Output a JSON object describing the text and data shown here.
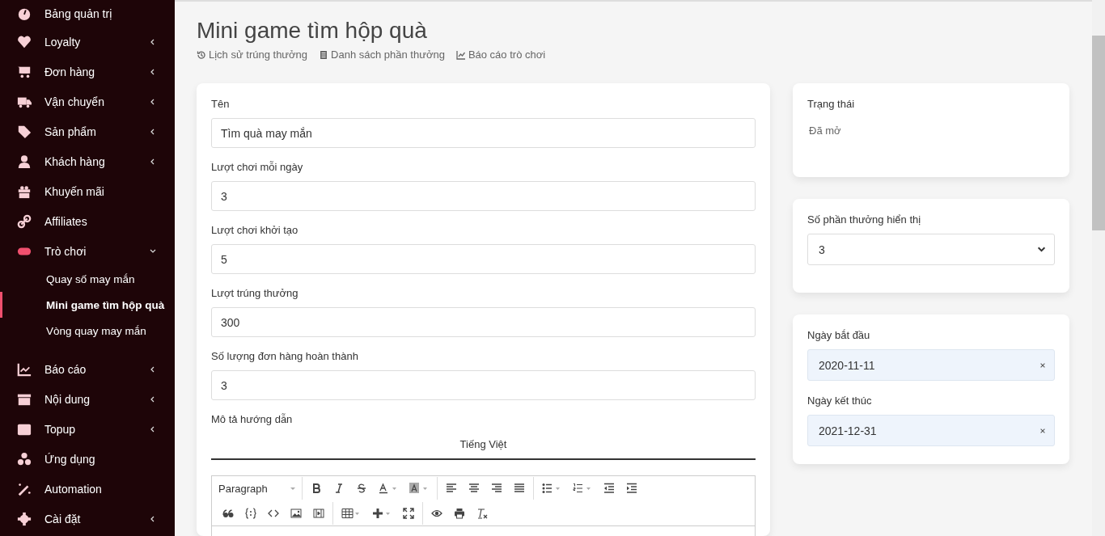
{
  "sidebar": {
    "items": [
      {
        "label": "Bảng quản trị",
        "kind": "link"
      },
      {
        "label": "Loyalty",
        "kind": "group",
        "expanded": false
      },
      {
        "label": "Đơn hàng",
        "kind": "group",
        "expanded": false
      },
      {
        "label": "Vận chuyển",
        "kind": "group",
        "expanded": false
      },
      {
        "label": "Sản phẩm",
        "kind": "group",
        "expanded": false
      },
      {
        "label": "Khách hàng",
        "kind": "group",
        "expanded": false
      },
      {
        "label": "Khuyến mãi",
        "kind": "link"
      },
      {
        "label": "Affiliates",
        "kind": "link"
      },
      {
        "label": "Trò chơi",
        "kind": "group",
        "expanded": true,
        "children": [
          {
            "label": "Quay số may mắn",
            "selected": false
          },
          {
            "label": "Mini game tìm hộp quà",
            "selected": true
          },
          {
            "label": "Vòng quay may mắn",
            "selected": false
          }
        ]
      },
      {
        "label": "Báo cáo",
        "kind": "group",
        "expanded": false
      },
      {
        "label": "Nội dung",
        "kind": "group",
        "expanded": false
      },
      {
        "label": "Topup",
        "kind": "group",
        "expanded": false
      },
      {
        "label": "Ứng dụng",
        "kind": "link"
      },
      {
        "label": "Automation",
        "kind": "link"
      },
      {
        "label": "Cài đặt",
        "kind": "group",
        "expanded": false
      }
    ]
  },
  "page": {
    "title": "Mini game tìm hộp quà",
    "links": [
      "Lịch sử trúng thưởng",
      "Danh sách phần thưởng",
      "Báo cáo trò chơi"
    ]
  },
  "form": {
    "fields": [
      {
        "label": "Tên",
        "value": "Tìm quà may mắn"
      },
      {
        "label": "Lượt chơi mỗi ngày",
        "value": "3"
      },
      {
        "label": "Lượt chơi khởi tạo",
        "value": "5"
      },
      {
        "label": "Lượt trúng thưởng",
        "value": "300"
      },
      {
        "label": "Số lượng đơn hàng hoàn thành",
        "value": "3"
      }
    ],
    "description": {
      "label": "Mô tả hướng dẫn",
      "language_tab": "Tiếng Việt",
      "format": "Paragraph"
    }
  },
  "status": {
    "label": "Trạng thái",
    "value": "Đã mở"
  },
  "display_count": {
    "label": "Số phần thưởng hiển thị",
    "value": "3"
  },
  "dates": [
    {
      "label": "Ngày bắt đầu",
      "value": "2020-11-11"
    },
    {
      "label": "Ngày kết thúc",
      "value": "2021-12-31"
    }
  ]
}
